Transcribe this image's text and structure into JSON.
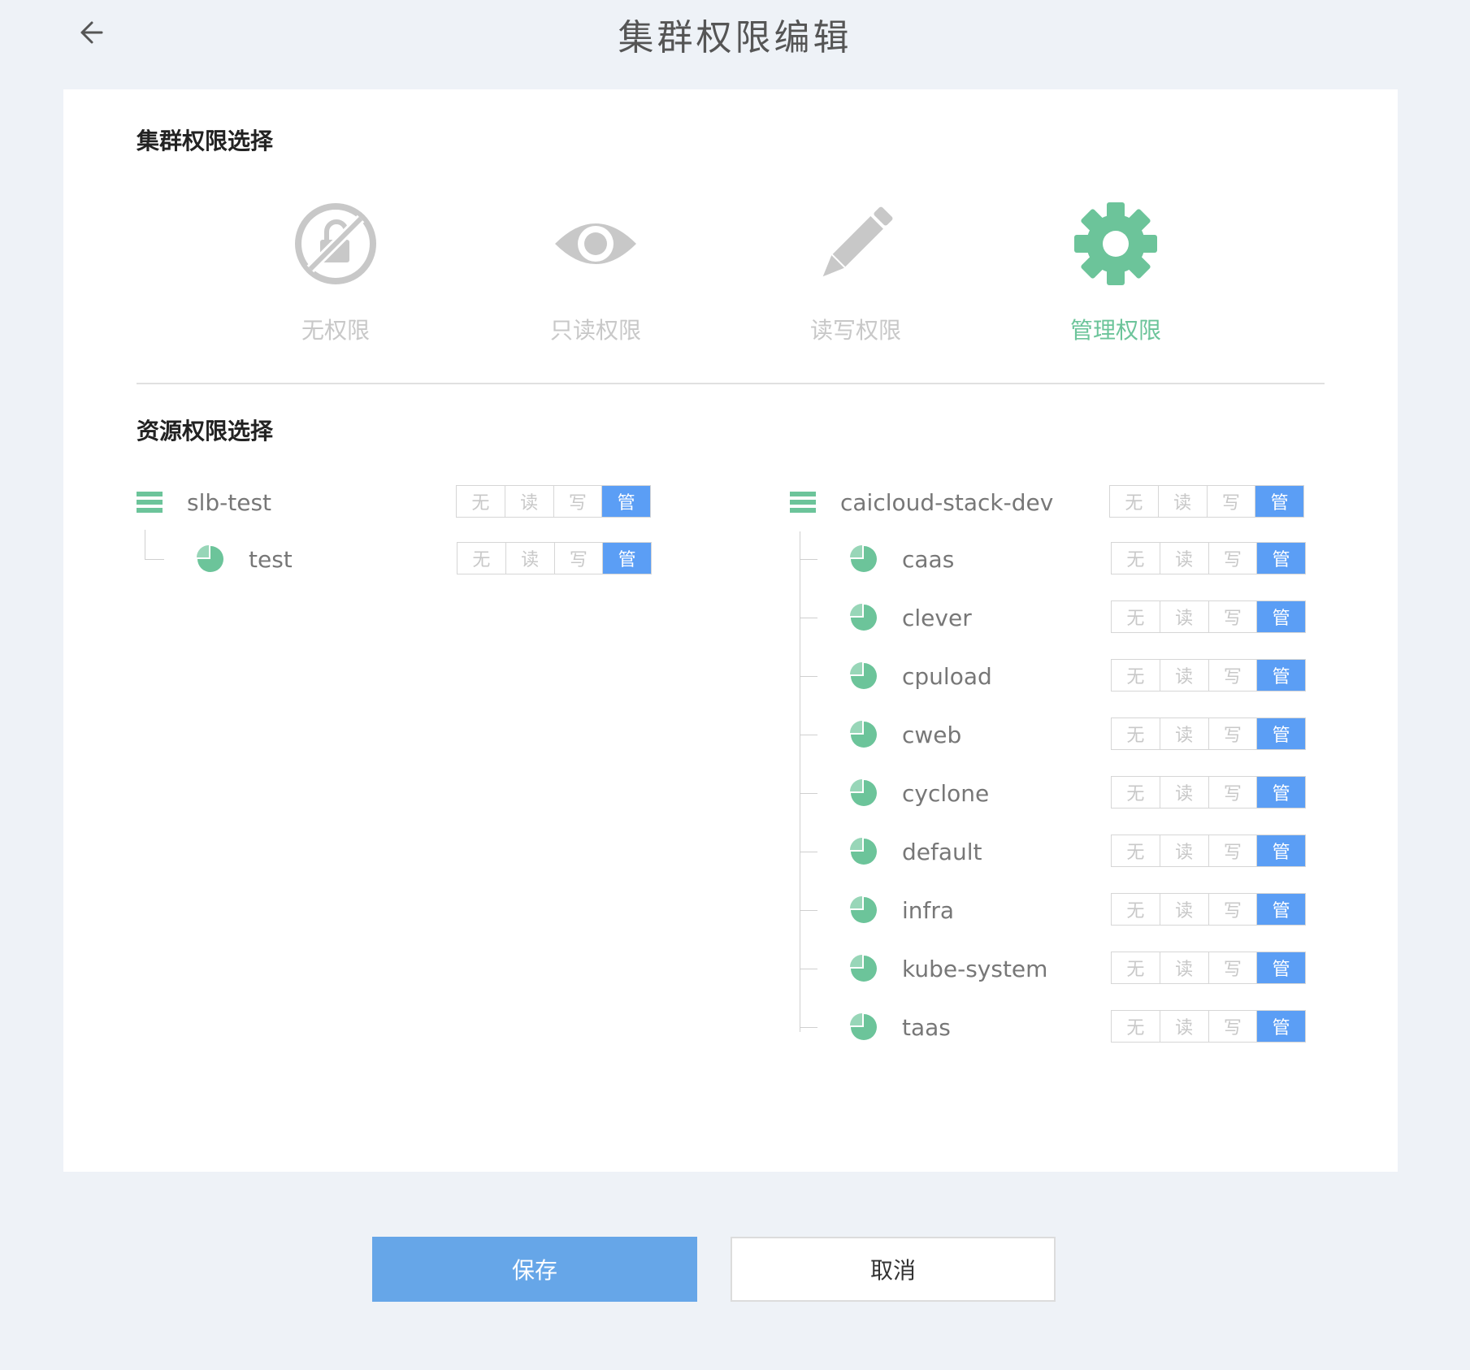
{
  "header": {
    "title": "集群权限编辑"
  },
  "cluster_section": {
    "title": "集群权限选择",
    "options": [
      {
        "label": "无权限",
        "icon": "no-permission-icon",
        "active": false
      },
      {
        "label": "只读权限",
        "icon": "eye-icon",
        "active": false
      },
      {
        "label": "读写权限",
        "icon": "pencil-icon",
        "active": false
      },
      {
        "label": "管理权限",
        "icon": "gear-icon",
        "active": true
      }
    ]
  },
  "resource_section": {
    "title": "资源权限选择",
    "seg_labels": [
      "无",
      "读",
      "写",
      "管"
    ],
    "groups": [
      {
        "name": "slb-test",
        "selected": "管",
        "children": [
          {
            "name": "test",
            "selected": "管"
          }
        ]
      },
      {
        "name": "caicloud-stack-dev",
        "selected": "管",
        "children": [
          {
            "name": "caas",
            "selected": "管"
          },
          {
            "name": "clever",
            "selected": "管"
          },
          {
            "name": "cpuload",
            "selected": "管"
          },
          {
            "name": "cweb",
            "selected": "管"
          },
          {
            "name": "cyclone",
            "selected": "管"
          },
          {
            "name": "default",
            "selected": "管"
          },
          {
            "name": "infra",
            "selected": "管"
          },
          {
            "name": "kube-system",
            "selected": "管"
          },
          {
            "name": "taas",
            "selected": "管"
          }
        ]
      }
    ]
  },
  "actions": {
    "save": "保存",
    "cancel": "取消"
  },
  "colors": {
    "accent_green": "#6cc49a",
    "accent_blue": "#5b9ef5",
    "inactive": "#c8c8c8"
  }
}
